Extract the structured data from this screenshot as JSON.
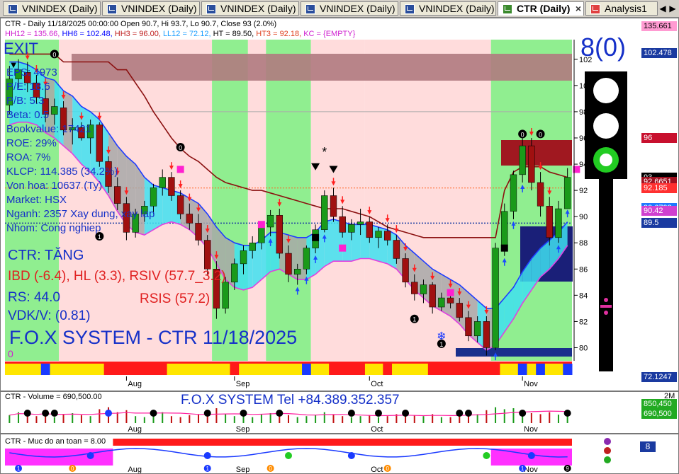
{
  "tabs": [
    {
      "label": "VNINDEX (Daily)",
      "active": false
    },
    {
      "label": "VNINDEX (Daily)",
      "active": false
    },
    {
      "label": "VNINDEX (Daily)",
      "active": false
    },
    {
      "label": "VNINDEX (Daily)",
      "active": false
    },
    {
      "label": "VNINDEX (Daily)",
      "active": false
    },
    {
      "label": "CTR (Daily)",
      "active": true
    },
    {
      "label": "Analysis1",
      "active": false
    }
  ],
  "tab_close": "×",
  "scroll_left": "◀",
  "scroll_right": "▶",
  "price_panel": {
    "header1": "CTR - Daily 11/18/2025 00:00:00 Open 90.7, Hi 93.7, Lo 90.7, Close 93 (2.0%)",
    "header2": {
      "hh12": "HH12 = 135.66,",
      "hh6": "HH6 = 102.48,",
      "hh3": "HH3 = 96.00,",
      "ll12": "LL12 = 72.12,",
      "ht": "HT = 89.50,",
      "ht3": "HT3 = 92.18,",
      "kc": "KC = {EMPTY}"
    },
    "exit_label": "EXIT",
    "info_lines": [
      "EPS: 4973",
      "P/E: 18.6",
      "P/B: 5.3",
      "Beta: 0.5",
      "Bookvalue: 17421",
      "ROE: 29%",
      "ROA: 7%",
      "KLCP: 114.385 (34.2%)",
      "Von hoa: 10637 (Ty)",
      "Market: HSX",
      "Nganh: 2357 Xay dung, xay lap",
      "Nhom: Cong nghiep"
    ],
    "status": "CTR: TĂNG",
    "ibd_line": "IBD (-6.4), HL (3.3), RSIV (57.7_3.2)",
    "rs_line": "RS: 44.0",
    "rsis_line": "RSIS (57.2)",
    "vdk_line": "VDK/V:  (0.81)",
    "watermark": "F.O.X SYSTEM - CTR 11/18/2025",
    "zero_label": "0",
    "signal_score": "8(0)",
    "signal_light_colors": [
      "#ffffff",
      "#ffffff",
      "#22cc22"
    ],
    "arrow_glyph": "▼",
    "snowflake_glyph": "❄",
    "star_glyph": "*",
    "price_tags": [
      {
        "value": "135.661",
        "color": "#ff9bd2",
        "text_color": "#000000"
      },
      {
        "value": "102.478",
        "color": "#1a3aa0",
        "text_color": "#ffffff"
      },
      {
        "value": "96",
        "color": "#c8102e",
        "text_color": "#ffffff"
      },
      {
        "value": "93",
        "color": "#000000",
        "text_color": "#ffffff"
      },
      {
        "value": "92.6651",
        "color": "#a01020",
        "text_color": "#ffffff"
      },
      {
        "value": "92.185",
        "color": "#ff3030",
        "text_color": "#ffffff"
      },
      {
        "value": "90.6798",
        "color": "#1e78ff",
        "text_color": "#ffffff"
      },
      {
        "value": "90.42",
        "color": "#d040d0",
        "text_color": "#ffffff"
      },
      {
        "value": "89.5",
        "color": "#1a3aa0",
        "text_color": "#ffffff"
      },
      {
        "value": "72.1247",
        "color": "#1a3aa0",
        "text_color": "#ffffff"
      }
    ]
  },
  "volume_panel": {
    "header": "CTR - Volume = 690,500.00",
    "banner": "F.O.X SYSTEM Tel +84.389.352.357",
    "y_label": "2M",
    "tags": [
      {
        "value": "850,450",
        "color": "#22aa22"
      },
      {
        "value": "690,500",
        "color": "#22aa22"
      }
    ]
  },
  "safety_panel": {
    "header": "CTR - Muc do an toan = 8.00",
    "tag": "8",
    "tag_color": "#1a3aa0",
    "marker_labels": [
      "1",
      "0",
      "9",
      "8"
    ]
  },
  "chart_data": {
    "type": "candlestick",
    "y_ticks": [
      80,
      82,
      84,
      86,
      88,
      90,
      92,
      94,
      96,
      98,
      100,
      102
    ],
    "ylim": [
      79,
      103.5
    ],
    "x_month_labels": [
      "Aug",
      "Sep",
      "Oct",
      "Nov"
    ],
    "series": [
      {
        "name": "CTR",
        "ohlc": [
          [
            98.5,
            101.5,
            97.8,
            100.5
          ],
          [
            100.5,
            102.0,
            99.8,
            101.2
          ],
          [
            101.0,
            101.8,
            99.5,
            100.2
          ],
          [
            100.2,
            100.8,
            98.6,
            99.1
          ],
          [
            99.0,
            99.8,
            97.2,
            97.8
          ],
          [
            97.8,
            99.0,
            97.0,
            98.4
          ],
          [
            98.3,
            98.8,
            96.2,
            96.6
          ],
          [
            96.6,
            97.5,
            95.5,
            96.8
          ],
          [
            96.8,
            97.2,
            95.8,
            96.0
          ],
          [
            96.0,
            97.4,
            94.8,
            97.0
          ],
          [
            97.0,
            97.2,
            93.8,
            94.2
          ],
          [
            94.2,
            94.6,
            91.8,
            92.3
          ],
          [
            92.3,
            93.0,
            90.5,
            91.0
          ],
          [
            91.0,
            91.5,
            88.2,
            88.8
          ],
          [
            88.8,
            90.6,
            88.4,
            90.2
          ],
          [
            90.2,
            91.2,
            89.6,
            90.8
          ],
          [
            90.8,
            92.5,
            90.2,
            92.2
          ],
          [
            92.2,
            93.6,
            91.6,
            93.0
          ],
          [
            93.0,
            93.4,
            91.2,
            91.6
          ],
          [
            91.6,
            92.0,
            89.8,
            90.2
          ],
          [
            90.2,
            91.0,
            89.0,
            89.5
          ],
          [
            89.5,
            90.2,
            87.8,
            88.2
          ],
          [
            88.2,
            88.6,
            85.5,
            86.0
          ],
          [
            86.0,
            86.6,
            82.2,
            83.0
          ],
          [
            83.0,
            85.4,
            82.6,
            85.0
          ],
          [
            85.0,
            86.8,
            84.4,
            86.4
          ],
          [
            86.4,
            87.8,
            85.6,
            87.4
          ],
          [
            87.4,
            88.5,
            86.8,
            88.0
          ],
          [
            88.0,
            89.5,
            87.5,
            89.2
          ],
          [
            89.2,
            90.5,
            88.5,
            90.1
          ],
          [
            90.1,
            90.6,
            86.8,
            87.2
          ],
          [
            87.2,
            87.8,
            85.0,
            85.6
          ],
          [
            85.6,
            86.4,
            84.8,
            86.0
          ],
          [
            86.0,
            87.8,
            85.6,
            87.6
          ],
          [
            87.6,
            89.4,
            87.2,
            89.0
          ],
          [
            89.0,
            92.0,
            88.8,
            91.6
          ],
          [
            91.6,
            92.2,
            89.6,
            90.0
          ],
          [
            90.0,
            90.8,
            88.4,
            88.8
          ],
          [
            88.8,
            89.8,
            88.2,
            89.4
          ],
          [
            89.4,
            90.6,
            88.6,
            89.6
          ],
          [
            89.6,
            90.0,
            88.0,
            88.4
          ],
          [
            88.4,
            89.2,
            87.6,
            88.9
          ],
          [
            88.9,
            89.4,
            87.8,
            88.2
          ],
          [
            88.2,
            88.6,
            86.4,
            86.8
          ],
          [
            86.8,
            87.2,
            84.6,
            85.0
          ],
          [
            85.0,
            85.6,
            83.6,
            84.1
          ],
          [
            84.1,
            85.2,
            83.4,
            84.8
          ],
          [
            84.8,
            85.0,
            82.6,
            83.1
          ],
          [
            83.1,
            84.2,
            82.8,
            83.8
          ],
          [
            83.8,
            84.4,
            83.0,
            83.4
          ],
          [
            83.4,
            83.8,
            82.0,
            82.3
          ],
          [
            82.3,
            82.8,
            80.5,
            80.9
          ],
          [
            80.9,
            82.4,
            80.4,
            82.0
          ],
          [
            82.0,
            82.4,
            79.4,
            80.0
          ],
          [
            80.0,
            88.0,
            79.8,
            87.6
          ],
          [
            87.6,
            91.0,
            87.0,
            90.4
          ],
          [
            90.4,
            93.5,
            89.8,
            93.2
          ],
          [
            93.2,
            96.0,
            92.6,
            95.4
          ],
          [
            95.4,
            96.0,
            92.0,
            92.6
          ],
          [
            92.6,
            93.4,
            90.0,
            90.8
          ],
          [
            90.8,
            91.5,
            87.8,
            88.4
          ],
          [
            88.4,
            91.2,
            88.0,
            90.6
          ],
          [
            90.6,
            93.7,
            90.7,
            93.0
          ]
        ]
      },
      {
        "name": "upper_band",
        "values": [
          101.8,
          101.8,
          101.6,
          101.2,
          100.6,
          100.4,
          99.6,
          99.2,
          98.4,
          98.0,
          97.4,
          96.4,
          95.4,
          94.6,
          94.0,
          93.0,
          92.4,
          92.2,
          92.0,
          91.8,
          91.4,
          91.0,
          90.2,
          89.2,
          88.4,
          88.0,
          87.8,
          87.8,
          88.2,
          88.8,
          88.8,
          88.6,
          88.4,
          88.4,
          88.8,
          89.6,
          89.8,
          89.6,
          89.4,
          89.4,
          89.4,
          89.2,
          89.0,
          88.6,
          87.8,
          87.2,
          86.6,
          86.0,
          85.6,
          85.2,
          84.8,
          84.2,
          83.6,
          83.0,
          83.0,
          83.8,
          84.6,
          85.8,
          86.8,
          87.6,
          88.2,
          88.8,
          89.6
        ]
      },
      {
        "name": "lower_band",
        "values": [
          97.0,
          97.2,
          97.2,
          97.0,
          96.4,
          96.0,
          95.4,
          94.8,
          94.0,
          93.4,
          92.6,
          91.6,
          90.4,
          89.4,
          88.8,
          88.6,
          89.0,
          89.4,
          89.6,
          89.4,
          89.0,
          88.4,
          87.6,
          86.4,
          85.2,
          84.6,
          84.4,
          84.6,
          85.2,
          85.8,
          86.0,
          85.6,
          85.2,
          85.2,
          85.6,
          86.2,
          86.6,
          86.6,
          86.6,
          86.8,
          86.8,
          86.6,
          86.4,
          86.0,
          85.2,
          84.4,
          83.8,
          83.2,
          82.8,
          82.4,
          81.8,
          81.0,
          80.4,
          79.8,
          80.2,
          81.2,
          82.2,
          83.4,
          84.4,
          85.4,
          86.0,
          86.8,
          87.8
        ]
      },
      {
        "name": "resistance",
        "values": [
          102.4,
          102.4,
          102.4,
          102.4,
          102.4,
          102.4,
          101.8,
          101.8,
          101.8,
          101.8,
          101.8,
          101.8,
          101.2,
          101.2,
          100.2,
          99.2,
          98.0,
          97.0,
          96.0,
          95.2,
          94.6,
          94.2,
          93.6,
          93.0,
          92.6,
          92.4,
          92.2,
          92.0,
          92.0,
          91.8,
          91.6,
          91.4,
          91.2,
          91.0,
          90.8,
          90.6,
          90.6,
          90.6,
          90.4,
          90.2,
          90.0,
          89.6,
          89.2,
          89.0,
          88.8,
          88.6,
          88.4,
          88.4,
          88.4,
          88.4,
          88.4,
          88.4,
          88.4,
          88.4,
          88.4,
          92.0,
          93.4,
          93.8,
          93.8,
          93.8,
          93.4,
          93.2,
          93.0
        ]
      }
    ],
    "volume": [
      0.8,
      1.1,
      0.9,
      0.7,
      1.2,
      0.6,
      0.9,
      1.0,
      0.8,
      0.7,
      1.4,
      1.6,
      1.1,
      1.3,
      0.7,
      0.6,
      0.9,
      1.1,
      0.7,
      0.6,
      0.8,
      0.9,
      1.2,
      1.5,
      0.9,
      0.7,
      0.8,
      0.6,
      0.9,
      1.0,
      1.2,
      0.8,
      0.6,
      0.7,
      0.8,
      1.1,
      0.9,
      0.7,
      0.6,
      0.7,
      0.8,
      0.6,
      0.7,
      0.9,
      1.0,
      0.8,
      0.7,
      0.9,
      0.6,
      0.6,
      0.8,
      1.1,
      0.9,
      1.3,
      1.6,
      1.4,
      1.5,
      1.3,
      1.0,
      0.9,
      1.1,
      0.85,
      0.69
    ],
    "volume_ylim": [
      0,
      2.0
    ]
  }
}
